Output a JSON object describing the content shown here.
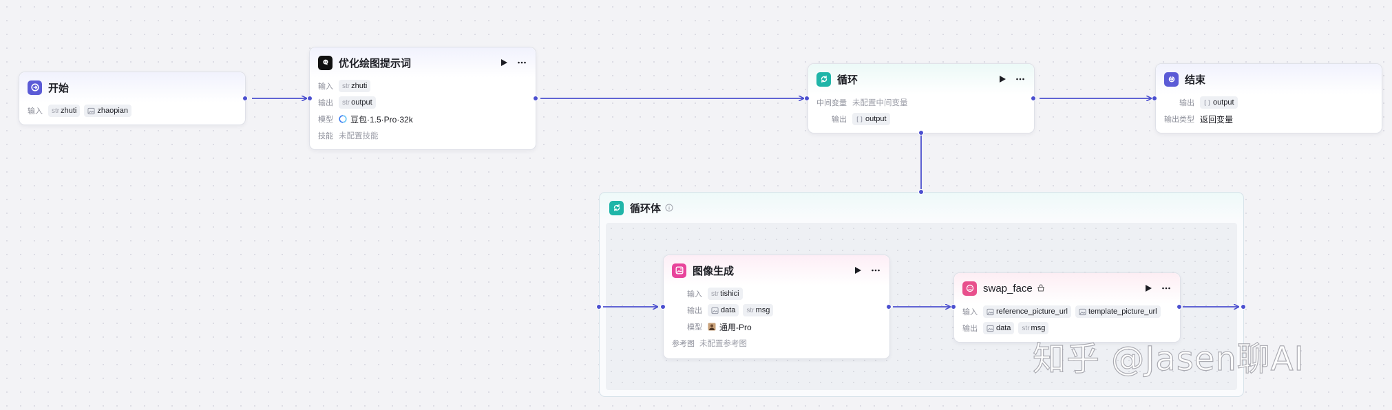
{
  "nodes": {
    "start": {
      "title": "开始",
      "input_label": "输入",
      "inputs": [
        {
          "type": "str",
          "name": "zhuti"
        },
        {
          "type": "image",
          "name": "zhaopian"
        }
      ]
    },
    "llm": {
      "title": "优化绘图提示词",
      "rows": {
        "input_label": "输入",
        "input_type": "str",
        "input_name": "zhuti",
        "output_label": "输出",
        "output_type": "str",
        "output_name": "output",
        "model_label": "模型",
        "model_name": "豆包·1.5·Pro·32k",
        "skill_label": "技能",
        "skill_value": "未配置技能"
      }
    },
    "loop": {
      "title": "循环",
      "mid_label": "中间变量",
      "mid_value": "未配置中间变量",
      "output_label": "输出",
      "output_type": "list",
      "output_name": "output"
    },
    "end": {
      "title": "结束",
      "output_label": "输出",
      "output_type": "list",
      "output_name": "output",
      "type_label": "输出类型",
      "type_value": "返回变量"
    },
    "loop_body": {
      "title": "循环体"
    },
    "image_gen": {
      "title": "图像生成",
      "input_label": "输入",
      "input_type": "str",
      "input_name": "tishici",
      "output_label": "输出",
      "output_1": "data",
      "output_2_type": "str",
      "output_2": "msg",
      "model_label": "模型",
      "model_name": "通用-Pro",
      "ref_label": "参考图",
      "ref_value": "未配置参考图"
    },
    "swap_face": {
      "title": "swap_face",
      "input_label": "输入",
      "input_1": "reference_picture_url",
      "input_2": "template_picture_url",
      "output_label": "输出",
      "output_1": "data",
      "output_2_type": "str",
      "output_2": "msg"
    }
  },
  "watermark": "知乎 @Jasen聊AI",
  "colors": {
    "edge": "#4b4fcf",
    "start_icon": "#5b5bd6",
    "loop_icon": "#1fb5a8",
    "image_gen_icon": "#e8449b",
    "swap_face_icon": "#e84f8c"
  },
  "icons": {
    "start": "start-icon",
    "llm": "llm-logo-icon",
    "loop": "loop-icon",
    "end": "end-icon",
    "image_gen": "image-gen-icon",
    "swap_face": "plugin-face-icon",
    "run": "play-icon",
    "more": "more-icon"
  }
}
